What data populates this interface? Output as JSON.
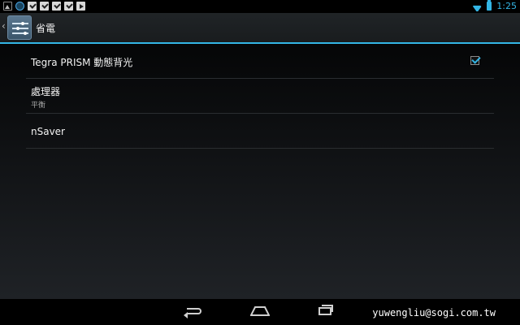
{
  "status_bar": {
    "notification_icons": [
      "gallery-icon",
      "globe-icon",
      "check-icon",
      "check-icon",
      "check-icon",
      "check-icon",
      "play-store-icon"
    ],
    "wifi_icon": "wifi-icon",
    "battery_icon": "battery-icon",
    "time": "1:25"
  },
  "action_bar": {
    "up_icon": "chevron-left-icon",
    "app_icon": "settings-sliders-icon",
    "title": "省電",
    "accent_color": "#33b5e5"
  },
  "preferences": [
    {
      "title": "Tegra PRISM 動態背光",
      "summary": "",
      "checked": true
    },
    {
      "title": "處理器",
      "summary": "平衡"
    },
    {
      "title": "nSaver",
      "summary": ""
    }
  ],
  "nav_bar": {
    "back_icon": "back-icon",
    "home_icon": "home-icon",
    "recents_icon": "recents-icon"
  },
  "watermark": "yuwengliu@sogi.com.tw"
}
